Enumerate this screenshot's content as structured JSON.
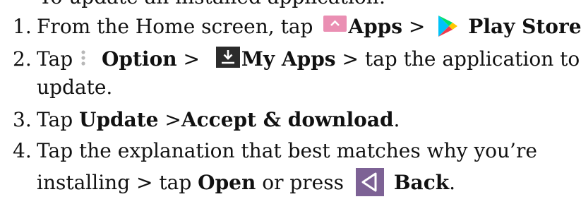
{
  "cut_off_line": "To update an installed application:",
  "steps": [
    {
      "number": "1.",
      "text_before": "From the Home screen, tap",
      "apps_label": "Apps",
      "separator": ">",
      "play_store_label": "Play Store",
      "period": "."
    },
    {
      "number": "2.",
      "text_before": "Tap",
      "option_label": "Option",
      "separator1": ">",
      "my_apps_label": "My Apps",
      "text_after": "> tap the application to",
      "continuation": "update."
    },
    {
      "number": "3.",
      "text_before": "Tap",
      "update_label": "Update",
      "separator": ">",
      "accept_label": "Accept & download",
      "period": "."
    },
    {
      "number": "4.",
      "line1": "Tap the explanation that best matches why you’re",
      "line2_before": "installing > tap",
      "open_label": "Open",
      "or_press": "or press",
      "back_label": "Back",
      "period": "."
    }
  ],
  "icons": {
    "apps": "apps-up-arrow-icon",
    "play_store": "play-store-icon",
    "option": "vertical-dots-icon",
    "my_apps": "download-icon",
    "back": "back-triangle-icon"
  },
  "colors": {
    "apps_icon_bg": "#ea8fb3",
    "my_apps_icon_bg": "#2b2b2b",
    "back_icon_bg": "#7d6295",
    "option_dots": "#b8b8b8"
  }
}
